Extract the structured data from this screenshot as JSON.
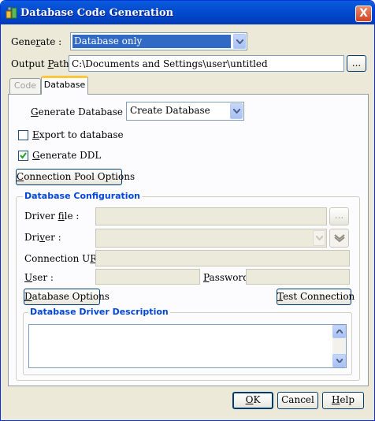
{
  "window": {
    "title": "Database Code Generation",
    "close_glyph": "X"
  },
  "generate": {
    "label": "Generate :",
    "value": "Database only"
  },
  "output_path": {
    "label": "Output Path :",
    "value": "C:\\Documents and Settings\\user\\untitled",
    "browse_label": "..."
  },
  "tabs": [
    {
      "label": "Code",
      "active": false
    },
    {
      "label": "Database",
      "active": true
    }
  ],
  "database_tab": {
    "generate_database": {
      "label": "Generate Database :",
      "value": "Create Database"
    },
    "export_to_database": {
      "label": "Export to database",
      "checked": false
    },
    "generate_ddl": {
      "label": "Generate DDL",
      "checked": true
    },
    "connection_pool_button": "Connection Pool Options",
    "config": {
      "title": "Database Configuration",
      "driver_file_label": "Driver file :",
      "driver_file_browse": "...",
      "driver_label": "Driver :",
      "connection_url_label": "Connection URL :",
      "user_label": "User :",
      "password_label": "Password :",
      "database_options_button": "Database Options",
      "test_connection_button": "Test Connection",
      "driver_description_title": "Database Driver Description",
      "driver_description_text": ""
    }
  },
  "footer": {
    "ok": "OK",
    "cancel": "Cancel",
    "help": "Help"
  },
  "colors": {
    "title_bar": "#0054e3",
    "selection": "#316ac5",
    "group_title": "#0046d5",
    "dialog_bg": "#ece9d8"
  }
}
